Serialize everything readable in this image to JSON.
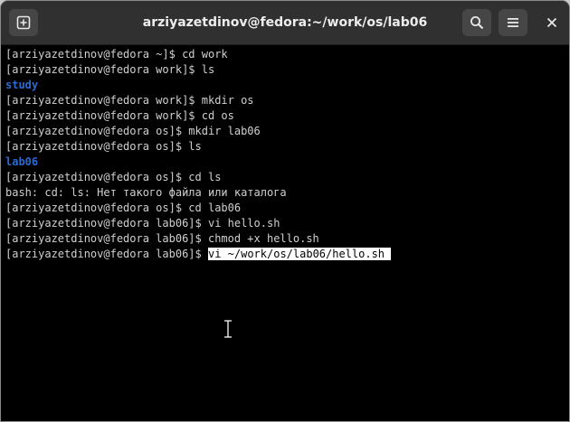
{
  "window": {
    "title": "arziyazetdinov@fedora:~/work/os/lab06",
    "new_tab_icon": "new-tab-icon",
    "search_icon": "search-icon",
    "menu_icon": "hamburger-menu-icon",
    "close_icon": "close-icon"
  },
  "terminal": {
    "colors": {
      "background": "#000000",
      "text": "#d0d0d0",
      "directory": "#2a6ad3",
      "selection": "#ffffff"
    },
    "lines": [
      "[arziyazetdinov@fedora ~]$ cd work",
      "[arziyazetdinov@fedora work]$ ls",
      "study",
      "[arziyazetdinov@fedora work]$ mkdir os",
      "[arziyazetdinov@fedora work]$ cd os",
      "[arziyazetdinov@fedora os]$ mkdir lab06",
      "[arziyazetdinov@fedora os]$ ls",
      "lab06",
      "[arziyazetdinov@fedora os]$ cd ls",
      "bash: cd: ls: Нет такого файла или каталога",
      "[arziyazetdinov@fedora os]$ cd lab06",
      "[arziyazetdinov@fedora lab06]$ vi hello.sh",
      "[arziyazetdinov@fedora lab06]$ chmod +x hello.sh"
    ],
    "last_prompt": "[arziyazetdinov@fedora lab06]$ ",
    "last_command_selected": "vi ~/work/os/lab06/hello.sh "
  }
}
